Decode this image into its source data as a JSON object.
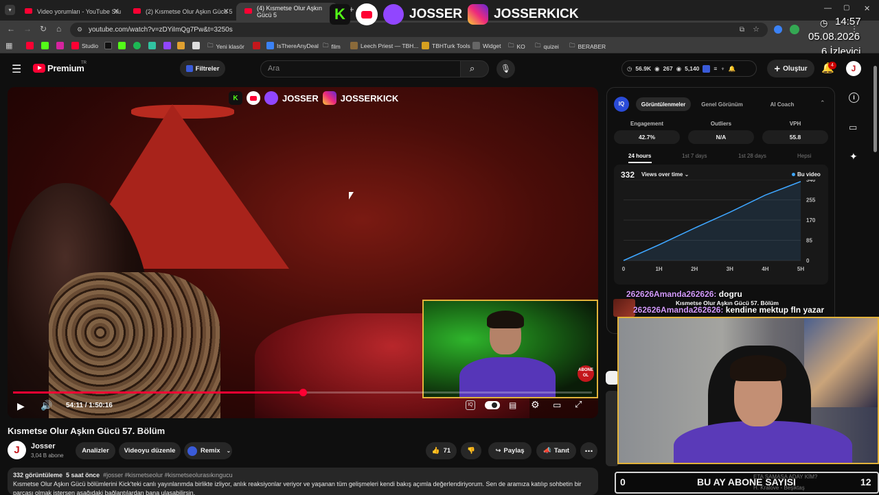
{
  "tabs": [
    {
      "title": "Video yorumları - YouTube Stu"
    },
    {
      "title": "(2) Kısmetse Olur Aşkın Gücü 5"
    },
    {
      "title": "(4) Kısmetse Olur Aşkın Gücü 5"
    }
  ],
  "address": {
    "url": "youtube.com/watch?v=zDYiImQg7Pw&t=3250s"
  },
  "bookmarks": [
    "Studio",
    "Yeni klasör",
    "IsThereAnyDeal",
    "film",
    "Leech Priest — TBH...",
    "TBHTurk Tools",
    "Widget",
    "KO",
    "quizei",
    "BERABER"
  ],
  "stream_overlay": {
    "brand": "JOSSER",
    "brand2": "JOSSERKICK",
    "time": "14:57",
    "date": "05.08.2026",
    "viewers": "6 İzleyici",
    "sub_count_left": "0",
    "sub_label": "BU AY ABONE SAYISI",
    "sub_count_right": "12",
    "ticker1": "ETA SAMASA ADAY KİM?",
    "ticker2": "H. Kralove - Beşiktaş",
    "abone": "ABONE OL"
  },
  "header": {
    "logo": "Premium",
    "logo_sup": "TR",
    "filters": "Filtreler",
    "search_placeholder": "Ara",
    "stat1": "56.9K",
    "stat2": "267",
    "stat3": "5,140",
    "create": "Oluştur",
    "notif_count": "4",
    "avatar": "J"
  },
  "player": {
    "time": "54:11 / 1:50:16",
    "progress": 0.5
  },
  "video": {
    "title": "Kısmetse Olur Aşkın Gücü 57. Bölüm",
    "channel": "Josser",
    "subs": "3,04 B abone",
    "analyze": "Analizler",
    "edit": "Videoyu düzenle",
    "remix": "Remix",
    "likes": "71",
    "share": "Paylaş",
    "promote": "Tanıt"
  },
  "description": {
    "views": "332 görüntüleme",
    "age": "5 saat önce",
    "tags": "#josser #kismetseolur #kismetseolurasıkıngucu",
    "text": "Kısmetse Olur Aşkın Gücü bölümlerini Kick'teki canlı yayınlarımda birlikte izliyor, anlık reaksiyonlar veriyor ve yaşanan tüm gelişmeleri kendi bakış açımla değerlendiriyorum. Sen de aramıza katılıp sohbetin bir parçası olmak istersen aşağıdaki bağlantılardan bana ulaşabilirsin."
  },
  "panel": {
    "tabs": [
      "Görüntülenmeler",
      "Genel Görünüm",
      "AI Coach"
    ],
    "metrics": [
      {
        "label": "Engagement",
        "value": "42.7%"
      },
      {
        "label": "Outliers",
        "value": "N/A"
      },
      {
        "label": "VPH",
        "value": "55.8"
      }
    ],
    "ranges": [
      "24 hours",
      "1st 7 days",
      "1st 28 days",
      "Hepsi"
    ],
    "views": "332",
    "dropdown": "Views over time",
    "legend": "Bu video"
  },
  "chat": [
    {
      "user": "262626Amanda262626:",
      "msg": "dogru"
    },
    {
      "user": "",
      "msg": "Kısmetse Olur Aşkın Gücü 57. Bölüm"
    },
    {
      "user": "262626Amanda262626:",
      "msg": "kendine mektup fln yazar"
    }
  ],
  "colors": {
    "accent": "#ff0033",
    "frame": "#e3b33a",
    "line": "#3ea6ff"
  },
  "chart_data": {
    "type": "line",
    "x": [
      0,
      1,
      2,
      3,
      4,
      5
    ],
    "xticks": [
      "0",
      "1H",
      "2H",
      "3H",
      "4H",
      "5H"
    ],
    "yticks": [
      "0",
      "85",
      "170",
      "255",
      "340"
    ],
    "values": [
      0,
      66,
      136,
      203,
      275,
      332
    ],
    "xlim": [
      0,
      5
    ],
    "ylim": [
      0,
      340
    ],
    "series": [
      {
        "name": "Bu video",
        "values": [
          0,
          66,
          136,
          203,
          275,
          332
        ]
      }
    ]
  }
}
